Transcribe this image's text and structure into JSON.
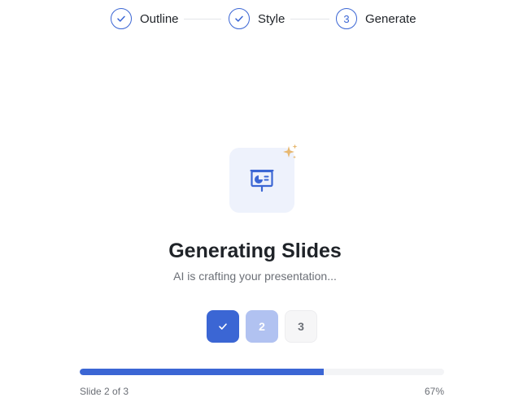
{
  "stepper": {
    "steps": [
      {
        "label": "Outline",
        "state": "complete",
        "icon": "check-icon"
      },
      {
        "label": "Style",
        "state": "complete",
        "icon": "check-icon"
      },
      {
        "label": "Generate",
        "state": "current",
        "number": "3"
      }
    ]
  },
  "hero": {
    "icon": "presentation-icon",
    "accent_icon": "sparkles-icon",
    "title": "Generating Slides",
    "subtitle": "AI is crafting your presentation..."
  },
  "slides": [
    {
      "label": "1",
      "state": "done",
      "icon": "check-icon"
    },
    {
      "label": "2",
      "state": "in-progress"
    },
    {
      "label": "3",
      "state": "pending"
    }
  ],
  "progress": {
    "caption": "Slide 2 of 3",
    "percent_label": "67%",
    "fraction": 0.67
  },
  "colors": {
    "accent": "#3b66d4",
    "accent_light": "#b1c2f1",
    "tile_bg": "#eef2fc",
    "sparkle": "#e7b871"
  }
}
